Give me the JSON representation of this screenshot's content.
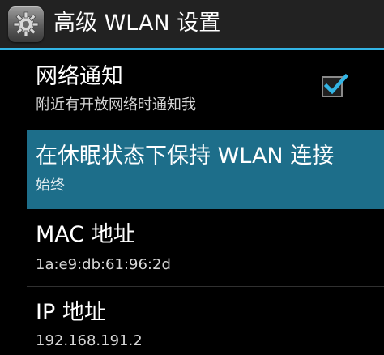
{
  "action_bar": {
    "title": "高级 WLAN 设置",
    "icon": "settings-gear-icon"
  },
  "preferences": {
    "network_notify": {
      "title": "网络通知",
      "summary": "附近有开放网络时通知我",
      "checked": true
    },
    "sleep_policy": {
      "title": "在休眠状态下保持 WLAN 连接",
      "summary": "始终"
    },
    "mac_address": {
      "title": "MAC 地址",
      "value": "1a:e9:db:61:96:2d"
    },
    "ip_address": {
      "title": "IP 地址",
      "value": "192.168.191.2"
    }
  },
  "colors": {
    "accent": "#33b5e5",
    "selected_row": "#1d6e8a",
    "background": "#000000"
  }
}
